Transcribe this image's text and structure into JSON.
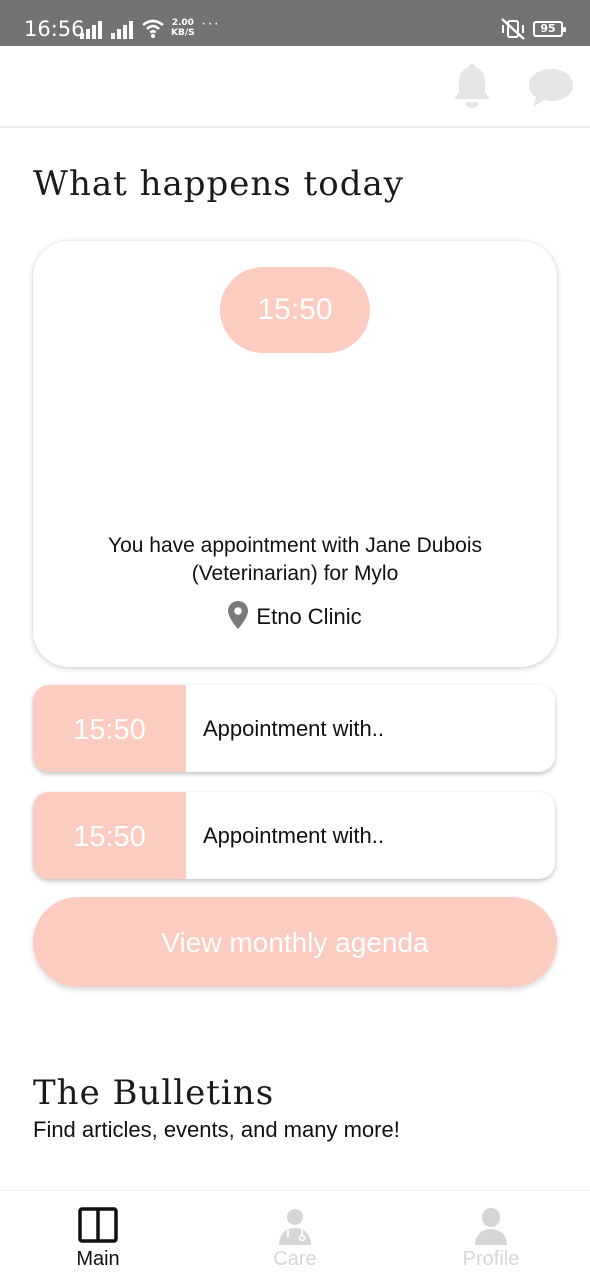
{
  "status_bar": {
    "time": "16:56",
    "net_speed_value": "2.00",
    "net_speed_unit": "KB/S",
    "more": "···",
    "battery": "95"
  },
  "header": {
    "icons": [
      "bell-icon",
      "chat-icon"
    ]
  },
  "today": {
    "title": "What happens today",
    "featured": {
      "time": "15:50",
      "description": "You have appointment with Jane Dubois (Veterinarian) for Mylo",
      "location": "Etno Clinic"
    },
    "appointments": [
      {
        "time": "15:50",
        "label": "Appointment with.."
      },
      {
        "time": "15:50",
        "label": "Appointment with.."
      }
    ],
    "agenda_button": "View monthly agenda"
  },
  "bulletins": {
    "title": "The Bulletins",
    "subtitle": "Find articles, events, and many more!"
  },
  "bottom_nav": {
    "items": [
      {
        "label": "Main",
        "icon": "book-icon",
        "active": true
      },
      {
        "label": "Care",
        "icon": "doctor-icon",
        "active": false
      },
      {
        "label": "Profile",
        "icon": "user-icon",
        "active": false
      }
    ]
  },
  "colors": {
    "accent": "#fdccc0",
    "status_bar": "#737373",
    "inactive_nav": "#d6d6d6"
  }
}
